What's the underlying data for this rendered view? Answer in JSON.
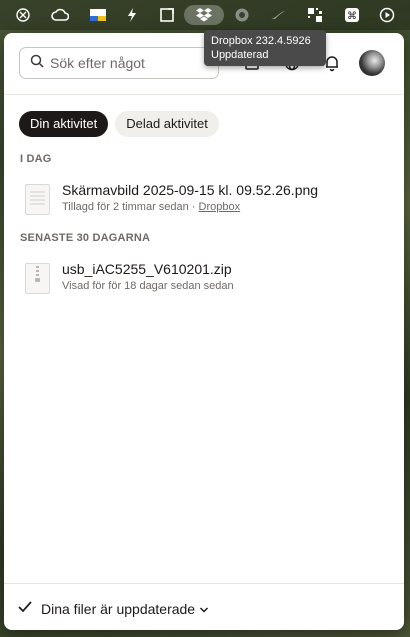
{
  "menubar": {
    "icons": [
      "openai-icon",
      "creative-cloud-icon",
      "flag-icon",
      "bolt-icon",
      "resize-icon",
      "dropbox-icon",
      "camera-icon",
      "swoosh-icon",
      "qr-icon",
      "command-icon",
      "play-icon"
    ]
  },
  "tooltip": {
    "line1": "Dropbox 232.4.5926",
    "line2": "Uppdaterad"
  },
  "search": {
    "placeholder": "Sök efter något"
  },
  "tabs": [
    {
      "label": "Din aktivitet",
      "active": true
    },
    {
      "label": "Delad aktivitet",
      "active": false
    }
  ],
  "sections": [
    {
      "title": "I DAG",
      "files": [
        {
          "name": "Skärmavbild 2025-09-15 kl. 09.52.26.png",
          "meta": "Tillagd för 2 timmar sedan · ",
          "meta_link": "Dropbox"
        }
      ]
    },
    {
      "title": "SENASTE 30 DAGARNA",
      "files": [
        {
          "name": "usb_iAC5255_V610201.zip",
          "meta": "Visad för för 18 dagar sedan sedan",
          "meta_link": ""
        }
      ]
    }
  ],
  "footer": {
    "status": "Dina filer är uppdaterade"
  },
  "colors": {
    "text": "#1e1919",
    "muted": "#6f6a66",
    "active_tab": "#1e1919"
  }
}
